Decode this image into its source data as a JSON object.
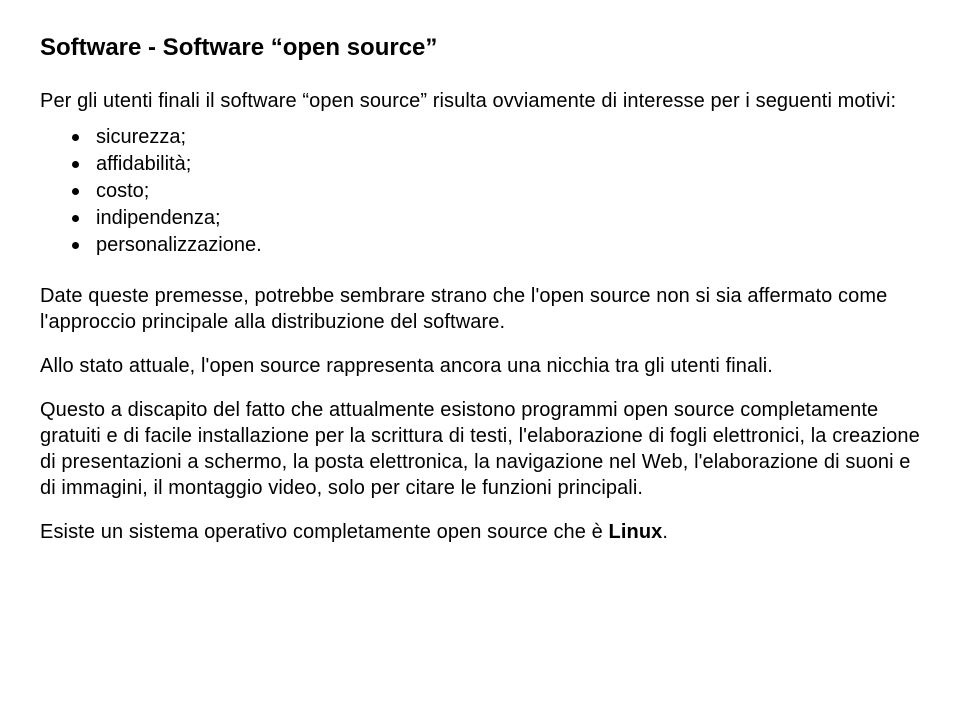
{
  "title": "Software - Software “open source”",
  "intro": "Per gli utenti finali il software “open source” risulta ovviamente di interesse per i seguenti motivi:",
  "bullets": [
    "sicurezza;",
    "affidabilità;",
    "costo;",
    "indipendenza;",
    "personalizzazione."
  ],
  "para2": "Date queste premesse, potrebbe sembrare strano che l'open source non si sia affermato come l'approccio principale alla distribuzione del software.",
  "para3": "Allo stato attuale, l'open source rappresenta ancora una nicchia tra gli utenti finali.",
  "para4": "Questo a discapito del fatto che attualmente esistono programmi open source completamente gratuiti e di facile installazione per la scrittura di testi, l'elaborazione di fogli elettronici, la creazione di presentazioni a schermo, la posta elettronica, la navigazione nel Web, l'elaborazione di suoni e di immagini, il montaggio video, solo per citare le funzioni principali.",
  "para5_pre": "Esiste un sistema operativo completamente open source che è ",
  "para5_bold": "Linux",
  "para5_post": "."
}
